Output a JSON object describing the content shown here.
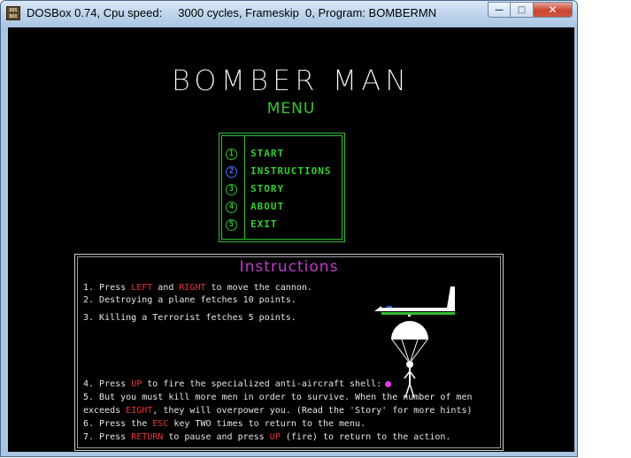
{
  "window": {
    "icon_text_top": "DOS",
    "icon_text_bottom": "BOX",
    "title": "DOSBox 0.74, Cpu speed:     3000 cycles, Frameskip  0, Program: BOMBERMN",
    "minimize": "—",
    "maximize": "□",
    "close": "✕"
  },
  "game": {
    "title": "BOMBER MAN",
    "menu_title": "MENU",
    "menu": [
      {
        "num": "1",
        "label": "START"
      },
      {
        "num": "2",
        "label": "INSTRUCTIONS"
      },
      {
        "num": "3",
        "label": "STORY"
      },
      {
        "num": "4",
        "label": "ABOUT"
      },
      {
        "num": "5",
        "label": "EXIT"
      }
    ]
  },
  "instructions": {
    "title": "Instructions",
    "l1a": "1. Press ",
    "l1b": "LEFT",
    "l1c": " and ",
    "l1d": "RIGHT",
    "l1e": " to move the cannon.",
    "l2": "2. Destroying a plane fetches 10 points.",
    "l3": "3. Killing a Terrorist fetches 5 points.",
    "l4a": "4. Press ",
    "l4b": "UP",
    "l4c": " to fire the specialized anti-aircraft shell:",
    "l5": "5. But you must kill more men in order to survive. When the number of men",
    "l6a": "exceeds ",
    "l6b": "EIGHT",
    "l6c": ", they will overpower you. (Read the 'Story' for more hints)",
    "l7a": "6. Press the ",
    "l7b": "ESC",
    "l7c": " key TWO times to return to the menu.",
    "l8a": "7. Press ",
    "l8b": "RETURN",
    "l8c": " to pause and press ",
    "l8d": "UP",
    "l8e": " (fire) to return to the action."
  }
}
